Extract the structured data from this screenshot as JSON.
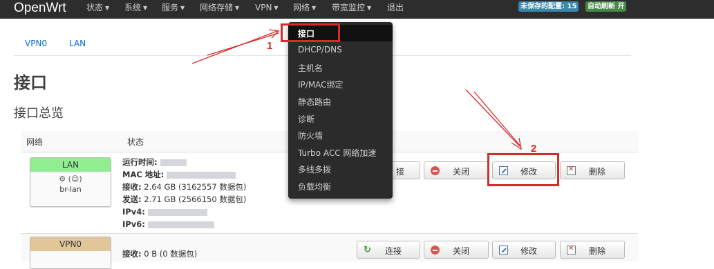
{
  "navbar": {
    "brand": "OpenWrt",
    "menus": [
      {
        "label": "状态"
      },
      {
        "label": "系统"
      },
      {
        "label": "服务"
      },
      {
        "label": "网络存储"
      },
      {
        "label": "VPN"
      },
      {
        "label": "网络"
      },
      {
        "label": "带宽监控"
      },
      {
        "label": "退出"
      }
    ],
    "unsaved_badge": "未保存的配置: 15",
    "autorefresh_badge": "自动刷新 开"
  },
  "tabs": [
    "VPN0",
    "LAN"
  ],
  "page_title": "接口",
  "section_title": "接口总览",
  "table": {
    "col_network": "网络",
    "col_status": "状态",
    "rows": [
      {
        "name": "LAN",
        "device": "br-lan",
        "header_color": "#90ee90",
        "uptime_label": "运行时间:",
        "mac_label": "MAC 地址:",
        "rx_label": "接收:",
        "rx_value": "2.64 GB (3162557 数据包)",
        "tx_label": "发送:",
        "tx_value": "2.71 GB (2566150 数据包)",
        "ipv4_label": "IPv4:",
        "ipv6_label": "IPv6:"
      },
      {
        "name": "VPN0",
        "header_color": "#e1c699",
        "rx_label": "接收:",
        "rx_value": "0 B (0 数据包)"
      }
    ],
    "buttons": {
      "connect": "连接",
      "connect_partial": "接",
      "close": "关闭",
      "edit": "修改",
      "delete": "删除"
    }
  },
  "dropdown": {
    "items": [
      {
        "label": "接口",
        "active": true
      },
      {
        "label": "DHCP/DNS"
      },
      {
        "label": "主机名"
      },
      {
        "label": "IP/MAC绑定"
      },
      {
        "label": "静态路由"
      },
      {
        "label": "诊断"
      },
      {
        "label": "防火墙"
      },
      {
        "label": "Turbo ACC 网络加速"
      },
      {
        "label": "多线多拨"
      },
      {
        "label": "负载均衡"
      }
    ]
  },
  "annotations": {
    "step1": "1",
    "step2": "2",
    "color": "#d52b2b"
  },
  "colors": {
    "navbar_bg": "#2d2d2d",
    "link": "#0069d6",
    "badge_blue": "#3a87ad",
    "badge_green": "#468847"
  }
}
